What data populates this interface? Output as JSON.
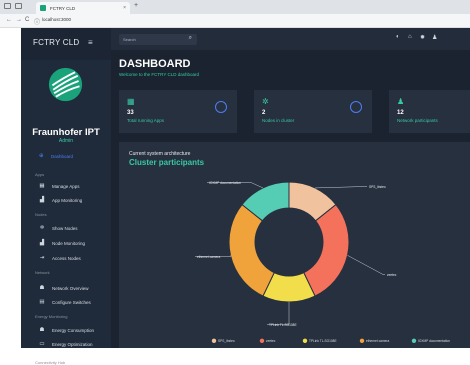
{
  "browser": {
    "tab_title": "FCTRY CLD",
    "tab_close": "×",
    "new_tab": "+",
    "url": "localhost:3000",
    "nav_back": "←",
    "nav_forward": "→",
    "nav_reload": "C",
    "info_icon": "ⓘ"
  },
  "sidebar": {
    "brand": "FCTRY CLD",
    "menu_icon": "≡",
    "org": "Fraunhofer IPT",
    "role": "Admin",
    "dashboard": {
      "icon": "⊕",
      "label": "Dashboard"
    },
    "sections": [
      {
        "title": "Apps",
        "items": [
          {
            "icon": "▦",
            "label": "Manage Apps"
          },
          {
            "icon": "▟",
            "label": "App Monitoring"
          }
        ]
      },
      {
        "title": "Nodes",
        "items": [
          {
            "icon": "✲",
            "label": "Show Nodes"
          },
          {
            "icon": "▟",
            "label": "Node Monitoring"
          },
          {
            "icon": "⇥",
            "label": "Access Nodes"
          }
        ]
      },
      {
        "title": "Network",
        "items": [
          {
            "icon": "☗",
            "label": "Network Overview"
          },
          {
            "icon": "▤",
            "label": "Configure Switches"
          }
        ]
      },
      {
        "title": "Energy Monitoring",
        "items": [
          {
            "icon": "☗",
            "label": "Energy Consumption"
          },
          {
            "icon": "▭",
            "label": "Energy Optimization"
          }
        ]
      },
      {
        "title": "Connectivity Hub",
        "items": []
      }
    ]
  },
  "topbar": {
    "search_placeholder": "Search",
    "search_icon": "⌕",
    "icons": [
      "◐",
      "⌂",
      "✹",
      "♟"
    ]
  },
  "page": {
    "title": "DASHBOARD",
    "subtitle": "Welcome to the FCTRY CLD dashboard"
  },
  "cards": [
    {
      "icon": "▦",
      "value": "33",
      "label": "Total running Apps",
      "ring": true
    },
    {
      "icon": "✲",
      "value": "2",
      "label": "Nodes in cluster",
      "ring": true
    },
    {
      "icon": "♟",
      "value": "12",
      "label": "Network participants",
      "ring": false
    }
  ],
  "panel": {
    "subtitle": "Current system architecture",
    "title": "Cluster participants"
  },
  "chart_data": {
    "type": "pie",
    "title": "Cluster participants",
    "labels": [
      "SPS_ibsteo",
      "zeetec",
      "TPLink TL-SG108E",
      "ethernet camera",
      "IOXMP documentation"
    ],
    "values": [
      1,
      2,
      1,
      2,
      1
    ],
    "colors": [
      "#f0c29d",
      "#f4715c",
      "#f2de4a",
      "#f0a23b",
      "#55cdb4"
    ],
    "callouts": [
      "SPS_ibsteo",
      "zeetec",
      "TPLink TL-SG108E",
      "ethernet camera",
      "IOXMP documentation"
    ],
    "legend": [
      "SPS_ibsteo",
      "zeetec",
      "TPLink TL-SG108E",
      "ethernet camera",
      "IOXMP documentation"
    ],
    "legend_position": "bottom"
  }
}
